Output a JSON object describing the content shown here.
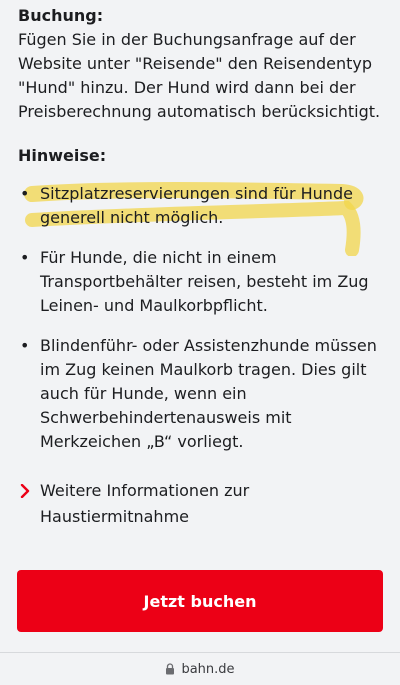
{
  "booking": {
    "heading": "Buchung:",
    "lines": [
      "Fügen Sie in der Buchungsanfrage auf der",
      "Website unter \"Reisende\" den Reisendentyp",
      "\"Hund\" hinzu. Der Hund wird dann bei der",
      "Preisberechnung automatisch berücksichtigt."
    ]
  },
  "notes": {
    "heading": "Hinweise:",
    "items": [
      {
        "lines": [
          "Sitzplatzreservierungen sind für Hunde",
          "generell nicht möglich."
        ],
        "highlighted": true
      },
      {
        "lines": [
          "Für Hunde, die nicht in einem",
          "Transportbehälter reisen, besteht im Zug",
          "Leinen- und Maulkorbpflicht."
        ]
      },
      {
        "lines": [
          "Blindenführ- oder Assistenzhunde müssen",
          "im Zug keinen Maulkorb tragen. Dies gilt",
          "auch für Hunde, wenn ein",
          "Schwerbehindertenausweis mit",
          "Merkzeichen „B“ vorliegt."
        ]
      }
    ],
    "bullet": "•",
    "highlight_color": "#f2d64b"
  },
  "more_info": {
    "lines": [
      "Weitere Informationen zur",
      "Haustiermitnahme"
    ],
    "icon": "chevron-right-icon"
  },
  "cta": {
    "label": "Jetzt buchen",
    "color": "#ec0016"
  },
  "browser_bar": {
    "domain": "bahn.de",
    "icon": "lock-icon"
  }
}
